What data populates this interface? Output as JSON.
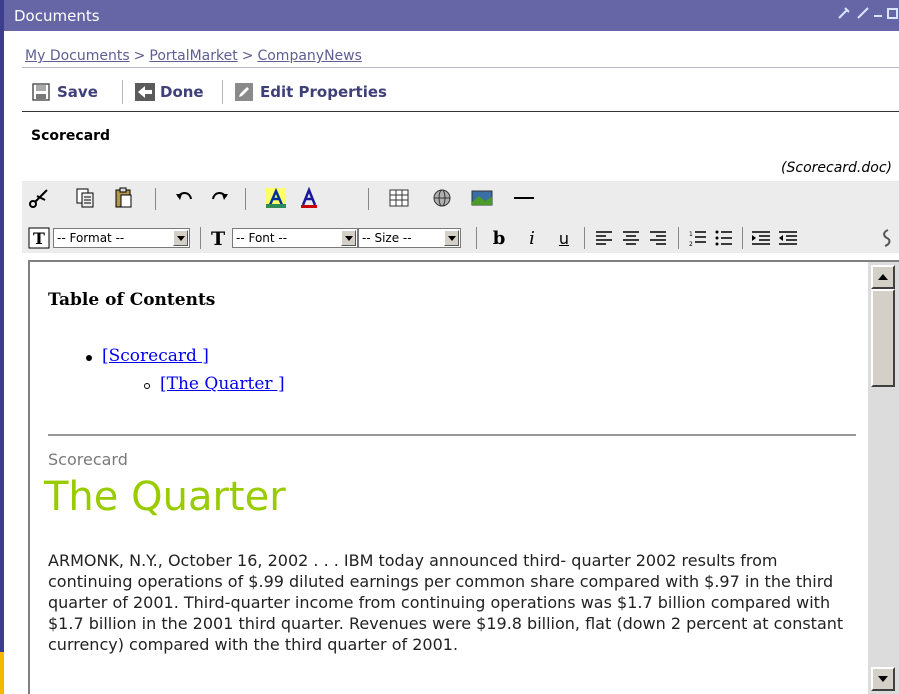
{
  "window": {
    "title": "Documents"
  },
  "breadcrumb": {
    "items": [
      "My Documents",
      "PortalMarket",
      "CompanyNews"
    ],
    "separator": ">"
  },
  "actions": {
    "save": "Save",
    "done": "Done",
    "edit_properties": "Edit Properties"
  },
  "document": {
    "name": "Scorecard",
    "file": "(Scorecard.doc)"
  },
  "format_toolbar": {
    "format_select": "-- Format --",
    "font_select": "-- Font --",
    "size_select": "-- Size --",
    "bold": "b",
    "italic": "i",
    "underline": "u"
  },
  "content": {
    "toc_heading": "Table of Contents",
    "toc_items": [
      "[Scorecard ]",
      "[The Quarter ]"
    ],
    "section_label": "Scorecard",
    "heading": "The Quarter",
    "body": "ARMONK, N.Y., October 16, 2002 . . . IBM today announced third- quarter 2002 results from continuing operations of $.99 diluted earnings per common share compared with $.97 in the third quarter of 2001. Third-quarter income from continuing operations was $1.7 billion compared with $1.7 billion in the 2001 third quarter. Revenues were $19.8 billion, flat (down 2 percent at constant currency) compared with the third quarter of 2001."
  },
  "icons": [
    "cut-icon",
    "copy-icon",
    "paste-icon",
    "undo-icon",
    "redo-icon",
    "highlight-color-icon",
    "font-color-icon",
    "table-icon",
    "globe-link-icon",
    "image-icon",
    "horizontal-rule-icon",
    "format-icon",
    "font-icon",
    "align-left-icon",
    "align-center-icon",
    "align-right-icon",
    "numbered-list-icon",
    "bulleted-list-icon",
    "indent-icon",
    "outdent-icon",
    "spellcheck-icon"
  ],
  "colors": {
    "title_bar": "#6666a7",
    "heading_green": "#99cc00",
    "link_blue": "#0000ee",
    "accent_orange": "#f5b800"
  }
}
